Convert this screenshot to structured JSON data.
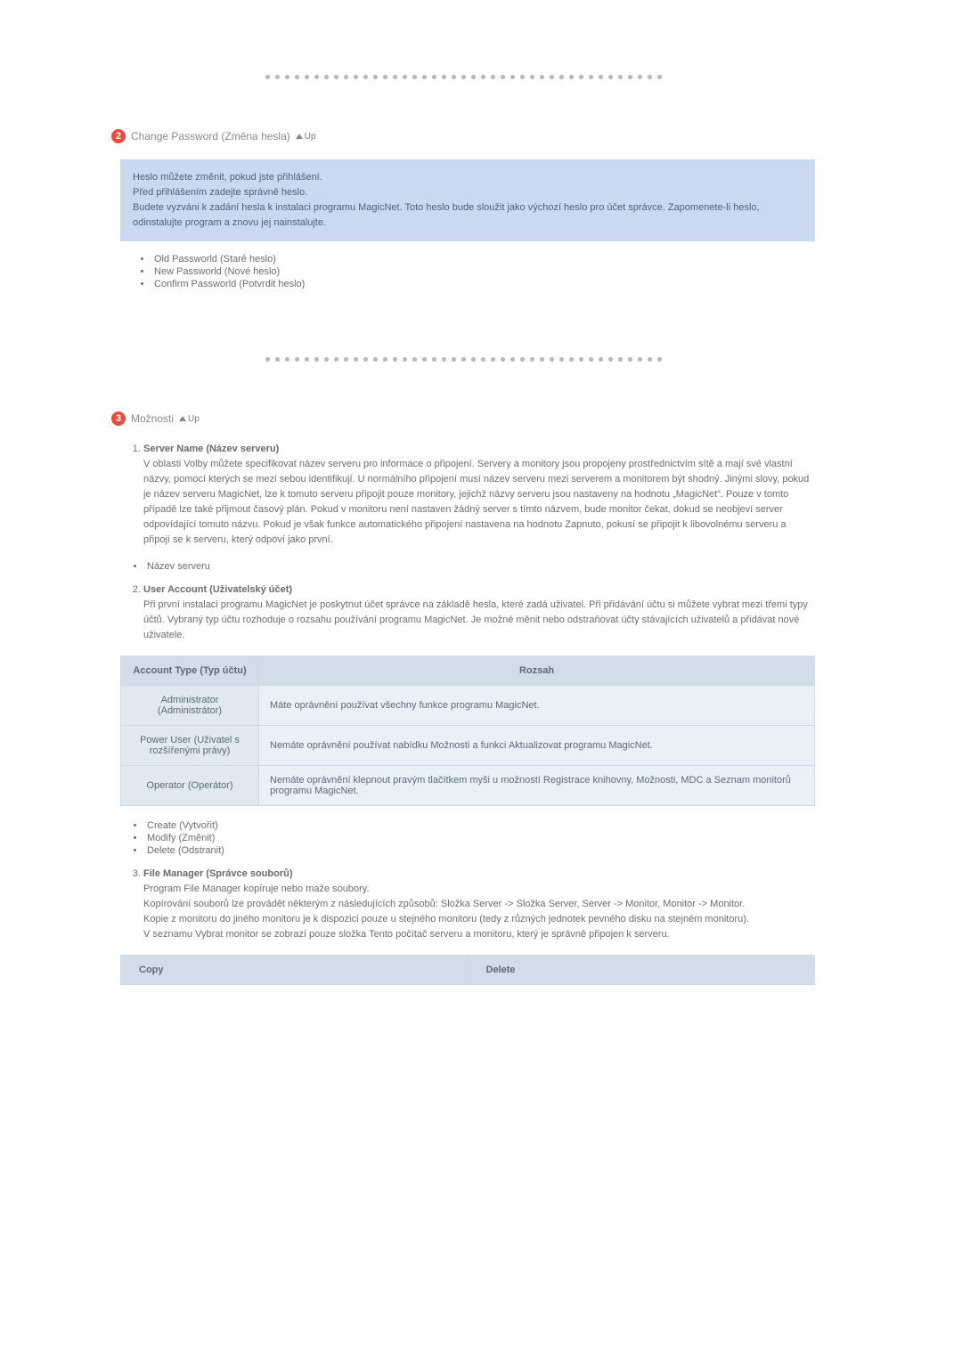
{
  "divider_dots": 41,
  "section2": {
    "num": "2",
    "title": "Change Password (Změna hesla)",
    "up": "Up",
    "intro": [
      "Heslo můžete změnit, pokud jste přihlášení.",
      "Před přihlášením zadejte správně heslo.",
      "Budete vyzváni k zadání hesla k instalaci programu MagicNet. Toto heslo bude sloužit jako výchozí heslo pro účet správce. Zapomenete-li heslo, odinstalujte program a znovu jej nainstalujte."
    ],
    "bullets": [
      "Old Passworld (Staré heslo)",
      "New Passworld (Nové heslo)",
      "Confirm Passworld (Potvrdit heslo)"
    ]
  },
  "section3": {
    "num": "3",
    "title": "Možnosti",
    "up": "Up",
    "sub1": {
      "title": "Server Name (Název serveru)",
      "body": "V oblasti Volby můžete specifikovat název serveru pro informace o připojení. Servery a monitory jsou propojeny prostřednictvím sítě a mají své vlastní názvy, pomocí kterých se mezi sebou identifikují. U normálního připojení musí název serveru mezi serverem a monitorem být shodný. Jinými slovy, pokud je název serveru MagicNet, lze k tomuto serveru připojit pouze monitory, jejichž názvy serveru jsou nastaveny na hodnotu „MagicNet“. Pouze v tomto případě lze také přijmout časový plán. Pokud v monitoru není nastaven žádný server s tímto názvem, bude monitor čekat, dokud se neobjeví server odpovídající tomuto názvu. Pokud je však funkce automatického připojení nastavena na hodnotu Zapnuto, pokusí se připojit k libovolnému serveru a připojí se k serveru, který odpoví jako první.",
      "bullets": [
        "Název serveru"
      ]
    },
    "sub2": {
      "title": "User Account (Uživatelský účet)",
      "body": "Při první instalaci programu MagicNet je poskytnut účet správce na základě hesla, které zadá uživatel. Při přidávání účtu si můžete vybrat mezi třemi typy účtů. Vybraný typ účtu rozhoduje o rozsahu používání programu MagicNet. Je možné měnit nebo odstraňovat účty stávajících uživatelů a přidávat nové uživatele.",
      "table": {
        "head": [
          "Account Type (Typ účtu)",
          "Rozsah"
        ],
        "rows": [
          {
            "type": "Administrator (Administrátor)",
            "scope": "Máte oprávnění používat všechny funkce programu MagicNet."
          },
          {
            "type": "Power User (Uživatel s rozšířenými právy)",
            "scope": "Nemáte oprávnění používat nabídku Možnosti a funkci Aktualizovat programu MagicNet."
          },
          {
            "type": "Operator (Operátor)",
            "scope": "Nemáte oprávnění klepnout pravým tlačítkem myši u možností Registrace knihovny, Možnosti, MDC a Seznam monitorů programu MagicNet."
          }
        ]
      },
      "actions": [
        "Create (Vytvořit)",
        "Modify (Změnit)",
        "Delete (Odstranit)"
      ]
    },
    "sub3": {
      "title": "File Manager (Správce souborů)",
      "lines": [
        "Program File Manager kopíruje nebo maže soubory.",
        "Kopírování souborů lze provádět některým z následujících způsobů: Složka Server -> Složka Server, Server -> Monitor, Monitor -> Monitor.",
        "Kopie z monitoru do jiného monitoru je k dispozici pouze u stejného monitoru (tedy z různých jednotek pevného disku na stejném monitoru).",
        "V seznamu Vybrat monitor se zobrazí pouze složka Tento počítač serveru a monitoru, který je správně připojen k serveru."
      ],
      "table_head": [
        "Copy",
        "Delete"
      ]
    }
  }
}
